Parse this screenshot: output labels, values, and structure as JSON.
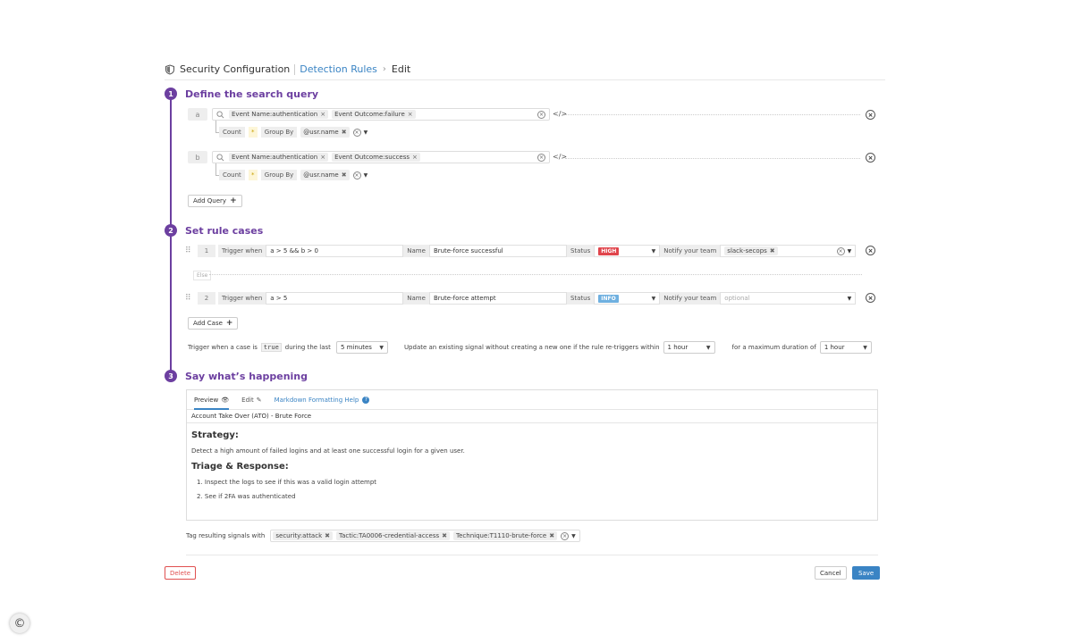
{
  "breadcrumb": {
    "root": "Security Configuration",
    "section": "Detection Rules",
    "current": "Edit"
  },
  "steps": [
    {
      "num": "1",
      "title": "Define the search query"
    },
    {
      "num": "2",
      "title": "Set rule cases"
    },
    {
      "num": "3",
      "title": "Say what’s happening"
    }
  ],
  "queries": [
    {
      "letter": "a",
      "filters": [
        "Event Name:authentication",
        "Event Outcome:failure"
      ],
      "count_label": "Count",
      "count_value": "*",
      "group_by_label": "Group By",
      "group_by_value": "@usr.name"
    },
    {
      "letter": "b",
      "filters": [
        "Event Name:authentication",
        "Event Outcome:success"
      ],
      "count_label": "Count",
      "count_value": "*",
      "group_by_label": "Group By",
      "group_by_value": "@usr.name"
    }
  ],
  "add_query_label": "Add Query",
  "cases": [
    {
      "num": "1",
      "trigger_label": "Trigger when",
      "trigger": "a > 5 && b > 0",
      "name_label": "Name",
      "name": "Brute-force successful",
      "status_label": "Status",
      "status": "HIGH",
      "status_color": "#e0454c",
      "notify_label": "Notify your team",
      "notify_value": "slack-secops",
      "notify_placeholder": ""
    },
    {
      "num": "2",
      "trigger_label": "Trigger when",
      "trigger": "a > 5",
      "name_label": "Name",
      "name": "Brute-force attempt",
      "status_label": "Status",
      "status": "INFO",
      "status_color": "#6fb0e0",
      "notify_label": "Notify your team",
      "notify_value": "",
      "notify_placeholder": "optional"
    }
  ],
  "else_label": "Else",
  "add_case_label": "Add Case",
  "trigger_settings": {
    "text1": "Trigger when a case is",
    "code": "true",
    "text2": "during the last",
    "window": "5 minutes",
    "text3": "Update an existing signal without creating a new one if the rule re-triggers within",
    "retrigger": "1 hour",
    "text4": "for a maximum duration of",
    "max_duration": "1 hour"
  },
  "markdown": {
    "tab_preview": "Preview",
    "tab_edit": "Edit",
    "help": "Markdown Formatting Help",
    "title": "Account Take Over (ATO) - Brute Force",
    "h_strategy": "Strategy:",
    "strategy_text": "Detect a high amount of failed logins and at least one successful login for a given user.",
    "h_triage": "Triage & Response:",
    "triage_items": [
      "1. Inspect the logs to see if this was a valid login attempt",
      "2. See if 2FA was authenticated"
    ]
  },
  "tags": {
    "label": "Tag resulting signals with",
    "values": [
      "security:attack",
      "Tactic:TA0006-credential-access",
      "Technique:T1110-brute-force"
    ]
  },
  "footer": {
    "delete": "Delete",
    "cancel": "Cancel",
    "save": "Save"
  },
  "copyright_glyph": "©",
  "colors": {
    "accent": "#6c3fa0",
    "link": "#3a84c4",
    "danger": "#e05050"
  }
}
